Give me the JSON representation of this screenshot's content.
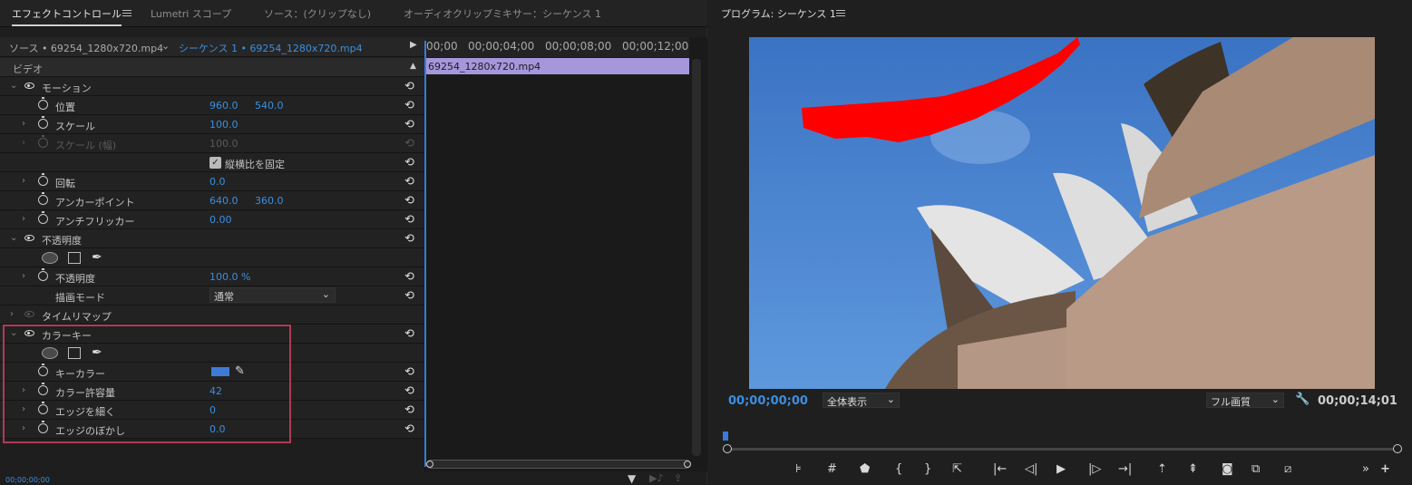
{
  "tabs": {
    "effect_controls": "エフェクトコントロール",
    "lumetri": "Lumetri スコープ",
    "source": "ソース：(クリップなし)",
    "audio_mixer": "オーディオクリップミキサー：シーケンス 1",
    "program": "プログラム: シーケンス 1"
  },
  "source_row": {
    "source": "ソース • 69254_1280x720.mp4",
    "sequence": "シーケンス 1 • 69254_1280x720.mp4"
  },
  "ruler_ticks": [
    "00;00",
    "00;00;04;00",
    "00;00;08;00",
    "00;00;12;00"
  ],
  "clip_name": "69254_1280x720.mp4",
  "video_label": "ビデオ",
  "motion": {
    "title": "モーション",
    "position_label": "位置",
    "position_x": "960.0",
    "position_y": "540.0",
    "scale_label": "スケール",
    "scale_value": "100.0",
    "scale_width_label": "スケール (幅)",
    "scale_width_value": "100.0",
    "uniform_label": "縦横比を固定",
    "rotation_label": "回転",
    "rotation_value": "0.0",
    "anchor_label": "アンカーポイント",
    "anchor_x": "640.0",
    "anchor_y": "360.0",
    "flicker_label": "アンチフリッカー",
    "flicker_value": "0.00"
  },
  "opacity": {
    "title": "不透明度",
    "opacity_label": "不透明度",
    "opacity_value": "100.0 %",
    "blend_label": "描画モード",
    "blend_value": "通常"
  },
  "time_remap": "タイムリマップ",
  "color_key": {
    "title": "カラーキー",
    "key_color_label": "キーカラー",
    "key_color": "#3f7bd6",
    "tolerance_label": "カラー許容量",
    "tolerance_value": "42",
    "thin_label": "エッジを細く",
    "thin_value": "0",
    "feather_label": "エッジのぼかし",
    "feather_value": "0.0"
  },
  "bottom_timecode": "00;00;00;00",
  "program": {
    "timecode": "00;00;00;00",
    "fit": "全体表示",
    "quality": "フル画質",
    "duration": "00;00;14;01"
  },
  "colors": {
    "accent": "#3b8fe0",
    "clip": "#a697dd",
    "highlight": "#b03a55",
    "key_red": "#ff0000"
  }
}
